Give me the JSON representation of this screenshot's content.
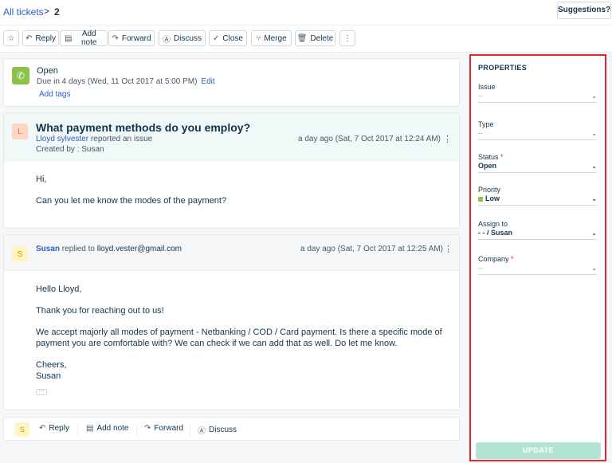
{
  "breadcrumb": {
    "link": "All tickets",
    "separator": ">",
    "current": "2"
  },
  "suggestions_label": "Suggestions?",
  "toolbar": {
    "star_icon": "star-icon",
    "reply": "Reply",
    "add_note": "Add note",
    "forward": "Forward",
    "discuss": "Discuss",
    "close": "Close",
    "merge": "Merge",
    "delete": "Delete",
    "more": "⋮"
  },
  "status_card": {
    "status": "Open",
    "due": "Due in 4 days (Wed, 11 Oct 2017 at 5:00 PM)",
    "edit": "Edit",
    "add_tags": "Add tags"
  },
  "issue": {
    "avatar": "L",
    "subject": "What payment methods do you employ?",
    "reporter_name": "Lloyd sylvester",
    "reporter_action": "reported an issue",
    "created_by": "Created by : Susan",
    "time": "a day ago (Sat, 7 Oct 2017 at 12:24 AM)",
    "lines": [
      "Hi,",
      "Can you let me know the modes of the payment?"
    ]
  },
  "reply": {
    "avatar": "S",
    "name": "Susan",
    "action": "replied to",
    "to": "lloyd.vester@gmail.com",
    "time": "a day ago (Sat, 7 Oct 2017 at 12:25 AM)",
    "greeting": "Hello Lloyd,",
    "thanks": "Thank you for reaching out to us!",
    "body_1": "We accept majorly all modes of payment - Netbanking / COD / Card payment. Is there a specific mode of",
    "body_2": "payment you are comfortable with? We can check if we can add that as well. Do let me know.",
    "sign_1": "Cheers,",
    "sign_2": "Susan",
    "ellipsis": "···"
  },
  "reply_bar": {
    "avatar": "S",
    "reply": "Reply",
    "add_note": "Add note",
    "forward": "Forward",
    "discuss": "Discuss"
  },
  "properties": {
    "title": "PROPERTIES",
    "issue_label": "Issue",
    "issue_value": "--",
    "type_label": "Type",
    "type_value": "--",
    "status_label": "Status",
    "status_value": "Open",
    "priority_label": "Priority",
    "priority_value": "Low",
    "priority_color": "#8bc34a",
    "assign_label": "Assign to",
    "assign_value": "- - / Susan",
    "company_label": "Company",
    "company_value": "--",
    "required_mark": "*",
    "update": "UPDATE"
  }
}
